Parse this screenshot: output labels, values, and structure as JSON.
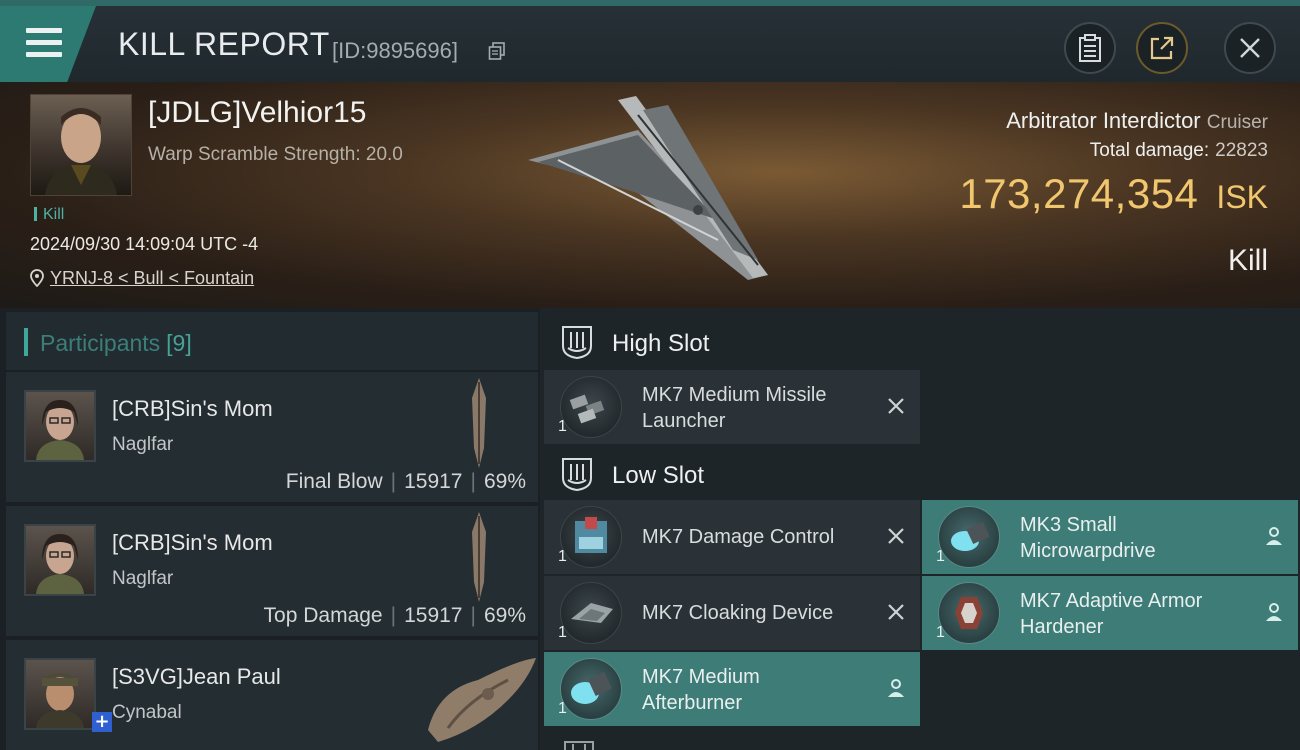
{
  "header": {
    "title": "KILL REPORT",
    "report_id": "[ID:9895696]"
  },
  "victim": {
    "pilot": "[JDLG]Velhior15",
    "warp_scramble": "Warp Scramble Strength: 20.0",
    "tag": "Kill",
    "datetime": "2024/09/30 14:09:04 UTC -4",
    "location": "YRNJ-8 < Bull < Fountain",
    "ship_name": "Arbitrator Interdictor",
    "ship_class": "Cruiser",
    "damage_label": "Total damage:",
    "damage_value": "22823",
    "isk_value": "173,274,354",
    "isk_unit": "ISK",
    "result": "Kill"
  },
  "participants": {
    "title": "Participants",
    "count": "[9]",
    "rows": [
      {
        "name": "[CRB]Sin's Mom",
        "ship": "Naglfar",
        "role": "Final Blow",
        "damage": "15917",
        "percent": "69%"
      },
      {
        "name": "[CRB]Sin's Mom",
        "ship": "Naglfar",
        "role": "Top Damage",
        "damage": "15917",
        "percent": "69%"
      },
      {
        "name": "[S3VG]Jean Paul",
        "ship": "Cynabal"
      }
    ]
  },
  "fitting": {
    "high_slot": {
      "label": "High Slot",
      "modules": [
        {
          "name_line1": "MK7 Medium Missile",
          "name_line2": "Launcher",
          "qty": "1",
          "state": "destroyed",
          "icon": "missile-launcher-icon"
        }
      ]
    },
    "low_slot": {
      "label": "Low Slot",
      "modules": [
        {
          "name_line1": "MK7 Damage Control",
          "name_line2": "",
          "qty": "1",
          "state": "destroyed",
          "icon": "damage-control-icon"
        },
        {
          "name_line1": "MK3 Small",
          "name_line2": "Microwarpdrive",
          "qty": "1",
          "state": "dropped",
          "icon": "microwarpdrive-icon"
        },
        {
          "name_line1": "MK7 Cloaking Device",
          "name_line2": "",
          "qty": "1",
          "state": "destroyed",
          "icon": "cloaking-device-icon"
        },
        {
          "name_line1": "MK7 Adaptive Armor",
          "name_line2": "Hardener",
          "qty": "1",
          "state": "dropped",
          "icon": "armor-hardener-icon"
        },
        {
          "name_line1": "MK7 Medium",
          "name_line2": "Afterburner",
          "qty": "1",
          "state": "dropped",
          "icon": "afterburner-icon"
        }
      ]
    }
  },
  "colors": {
    "accent_teal": "#3d7c77",
    "isk_gold": "#f0c66e",
    "menu_teal": "#2c7a72"
  }
}
